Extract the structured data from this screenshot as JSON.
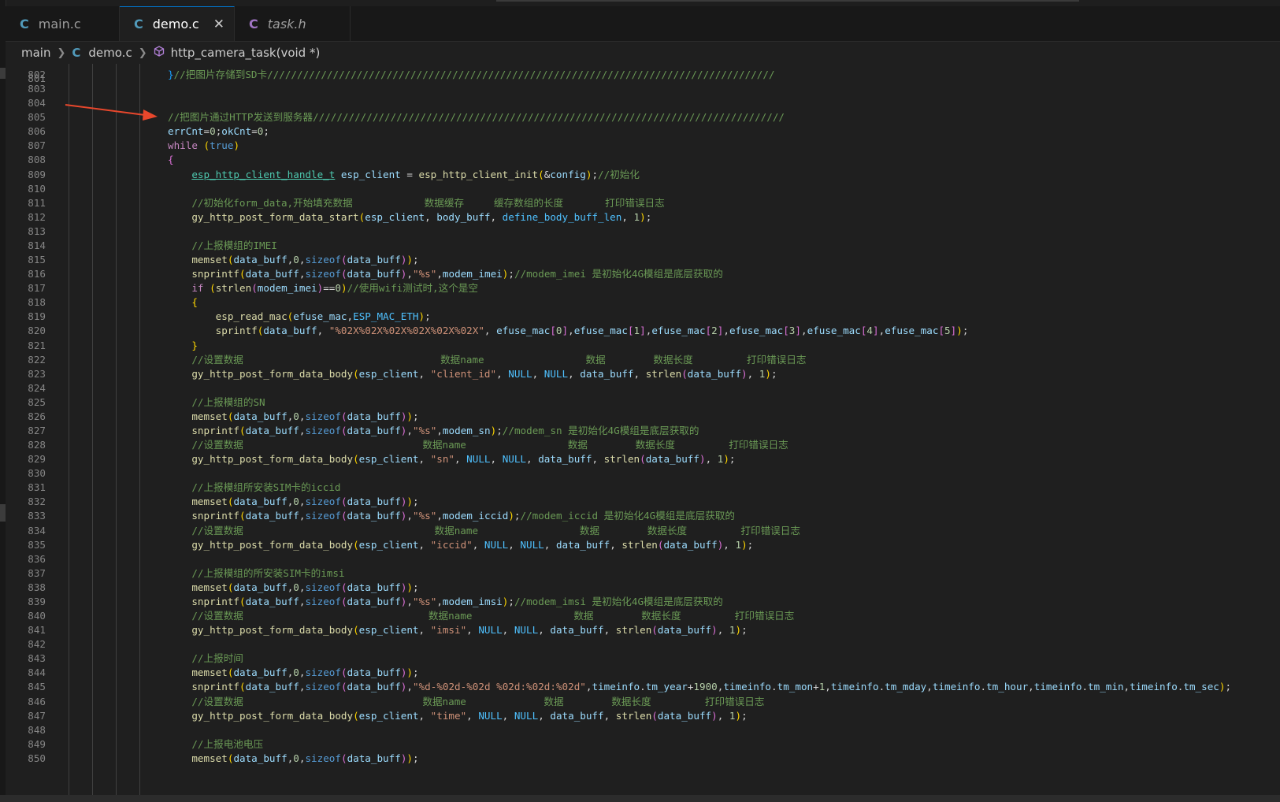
{
  "tabs": [
    {
      "label": "main.c",
      "icon": "C"
    },
    {
      "label": "demo.c",
      "icon": "C",
      "active": true,
      "close": "✕"
    },
    {
      "label": "task.h",
      "icon": "C"
    }
  ],
  "breadcrumb": {
    "folder": "main",
    "file_icon": "C",
    "file": "demo.c",
    "symbol": "http_camera_task(void *)"
  },
  "editor": {
    "partial_line_number": "801",
    "lines": [
      {
        "n": "802",
        "code": "}//把图片存储到SD卡/////////////////////////////////////////////////////////////////////////////////////"
      },
      {
        "n": "803",
        "code": ""
      },
      {
        "n": "804",
        "code": ""
      },
      {
        "n": "805",
        "code": "//把图片通过HTTP发送到服务器///////////////////////////////////////////////////////////////////////////////"
      },
      {
        "n": "806",
        "code": "errCnt=0;okCnt=0;"
      },
      {
        "n": "807",
        "code": "while (true)"
      },
      {
        "n": "808",
        "code": "{"
      },
      {
        "n": "809",
        "code": "    esp_http_client_handle_t esp_client = esp_http_client_init(&config);//初始化"
      },
      {
        "n": "810",
        "code": ""
      },
      {
        "n": "811",
        "code": "    //初始化form_data,开始填充数据            数据缓存     缓存数组的长度       打印错误日志"
      },
      {
        "n": "812",
        "code": "    gy_http_post_form_data_start(esp_client, body_buff, define_body_buff_len, 1);"
      },
      {
        "n": "813",
        "code": ""
      },
      {
        "n": "814",
        "code": "    //上报模组的IMEI"
      },
      {
        "n": "815",
        "code": "    memset(data_buff,0,sizeof(data_buff));"
      },
      {
        "n": "816",
        "code": "    snprintf(data_buff,sizeof(data_buff),\"%s\",modem_imei);//modem_imei 是初始化4G模组是底层获取的"
      },
      {
        "n": "817",
        "code": "    if (strlen(modem_imei)==0)//使用wifi测试时,这个是空"
      },
      {
        "n": "818",
        "code": "    {"
      },
      {
        "n": "819",
        "code": "        esp_read_mac(efuse_mac,ESP_MAC_ETH);"
      },
      {
        "n": "820",
        "code": "        sprintf(data_buff, \"%02X%02X%02X%02X%02X%02X\", efuse_mac[0],efuse_mac[1],efuse_mac[2],efuse_mac[3],efuse_mac[4],efuse_mac[5]);"
      },
      {
        "n": "821",
        "code": "    }"
      },
      {
        "n": "822",
        "code": "    //设置数据                                 数据name                 数据        数据长度         打印错误日志"
      },
      {
        "n": "823",
        "code": "    gy_http_post_form_data_body(esp_client, \"client_id\", NULL, NULL, data_buff, strlen(data_buff), 1);"
      },
      {
        "n": "824",
        "code": ""
      },
      {
        "n": "825",
        "code": "    //上报模组的SN"
      },
      {
        "n": "826",
        "code": "    memset(data_buff,0,sizeof(data_buff));"
      },
      {
        "n": "827",
        "code": "    snprintf(data_buff,sizeof(data_buff),\"%s\",modem_sn);//modem_sn 是初始化4G模组是底层获取的"
      },
      {
        "n": "828",
        "code": "    //设置数据                              数据name                 数据        数据长度         打印错误日志"
      },
      {
        "n": "829",
        "code": "    gy_http_post_form_data_body(esp_client, \"sn\", NULL, NULL, data_buff, strlen(data_buff), 1);"
      },
      {
        "n": "830",
        "code": ""
      },
      {
        "n": "831",
        "code": "    //上报模组所安装SIM卡的iccid"
      },
      {
        "n": "832",
        "code": "    memset(data_buff,0,sizeof(data_buff));"
      },
      {
        "n": "833",
        "code": "    snprintf(data_buff,sizeof(data_buff),\"%s\",modem_iccid);//modem_iccid 是初始化4G模组是底层获取的"
      },
      {
        "n": "834",
        "code": "    //设置数据                                数据name                 数据        数据长度         打印错误日志"
      },
      {
        "n": "835",
        "code": "    gy_http_post_form_data_body(esp_client, \"iccid\", NULL, NULL, data_buff, strlen(data_buff), 1);"
      },
      {
        "n": "836",
        "code": ""
      },
      {
        "n": "837",
        "code": "    //上报模组的所安装SIM卡的imsi"
      },
      {
        "n": "838",
        "code": "    memset(data_buff,0,sizeof(data_buff));"
      },
      {
        "n": "839",
        "code": "    snprintf(data_buff,sizeof(data_buff),\"%s\",modem_imsi);//modem_imsi 是初始化4G模组是底层获取的"
      },
      {
        "n": "840",
        "code": "    //设置数据                               数据name                 数据        数据长度         打印错误日志"
      },
      {
        "n": "841",
        "code": "    gy_http_post_form_data_body(esp_client, \"imsi\", NULL, NULL, data_buff, strlen(data_buff), 1);"
      },
      {
        "n": "842",
        "code": ""
      },
      {
        "n": "843",
        "code": "    //上报时间"
      },
      {
        "n": "844",
        "code": "    memset(data_buff,0,sizeof(data_buff));"
      },
      {
        "n": "845",
        "code": "    snprintf(data_buff,sizeof(data_buff),\"%d-%02d-%02d %02d:%02d:%02d\",timeinfo.tm_year+1900,timeinfo.tm_mon+1,timeinfo.tm_mday,timeinfo.tm_hour,timeinfo.tm_min,timeinfo.tm_sec);"
      },
      {
        "n": "846",
        "code": "    //设置数据                              数据name             数据        数据长度         打印错误日志"
      },
      {
        "n": "847",
        "code": "    gy_http_post_form_data_body(esp_client, \"time\", NULL, NULL, data_buff, strlen(data_buff), 1);"
      },
      {
        "n": "848",
        "code": ""
      },
      {
        "n": "849",
        "code": "    //上报电池电压"
      },
      {
        "n": "850",
        "code": "    memset(data_buff,0,sizeof(data_buff));"
      }
    ]
  },
  "colors": {
    "background": "#1f1f1f",
    "comment": "#6a9955",
    "keyword": "#c586c0",
    "function": "#dcdcaa",
    "variable": "#9cdcfe",
    "string": "#ce9178",
    "number": "#b5cea8",
    "annotation_arrow": "#e8472c"
  }
}
